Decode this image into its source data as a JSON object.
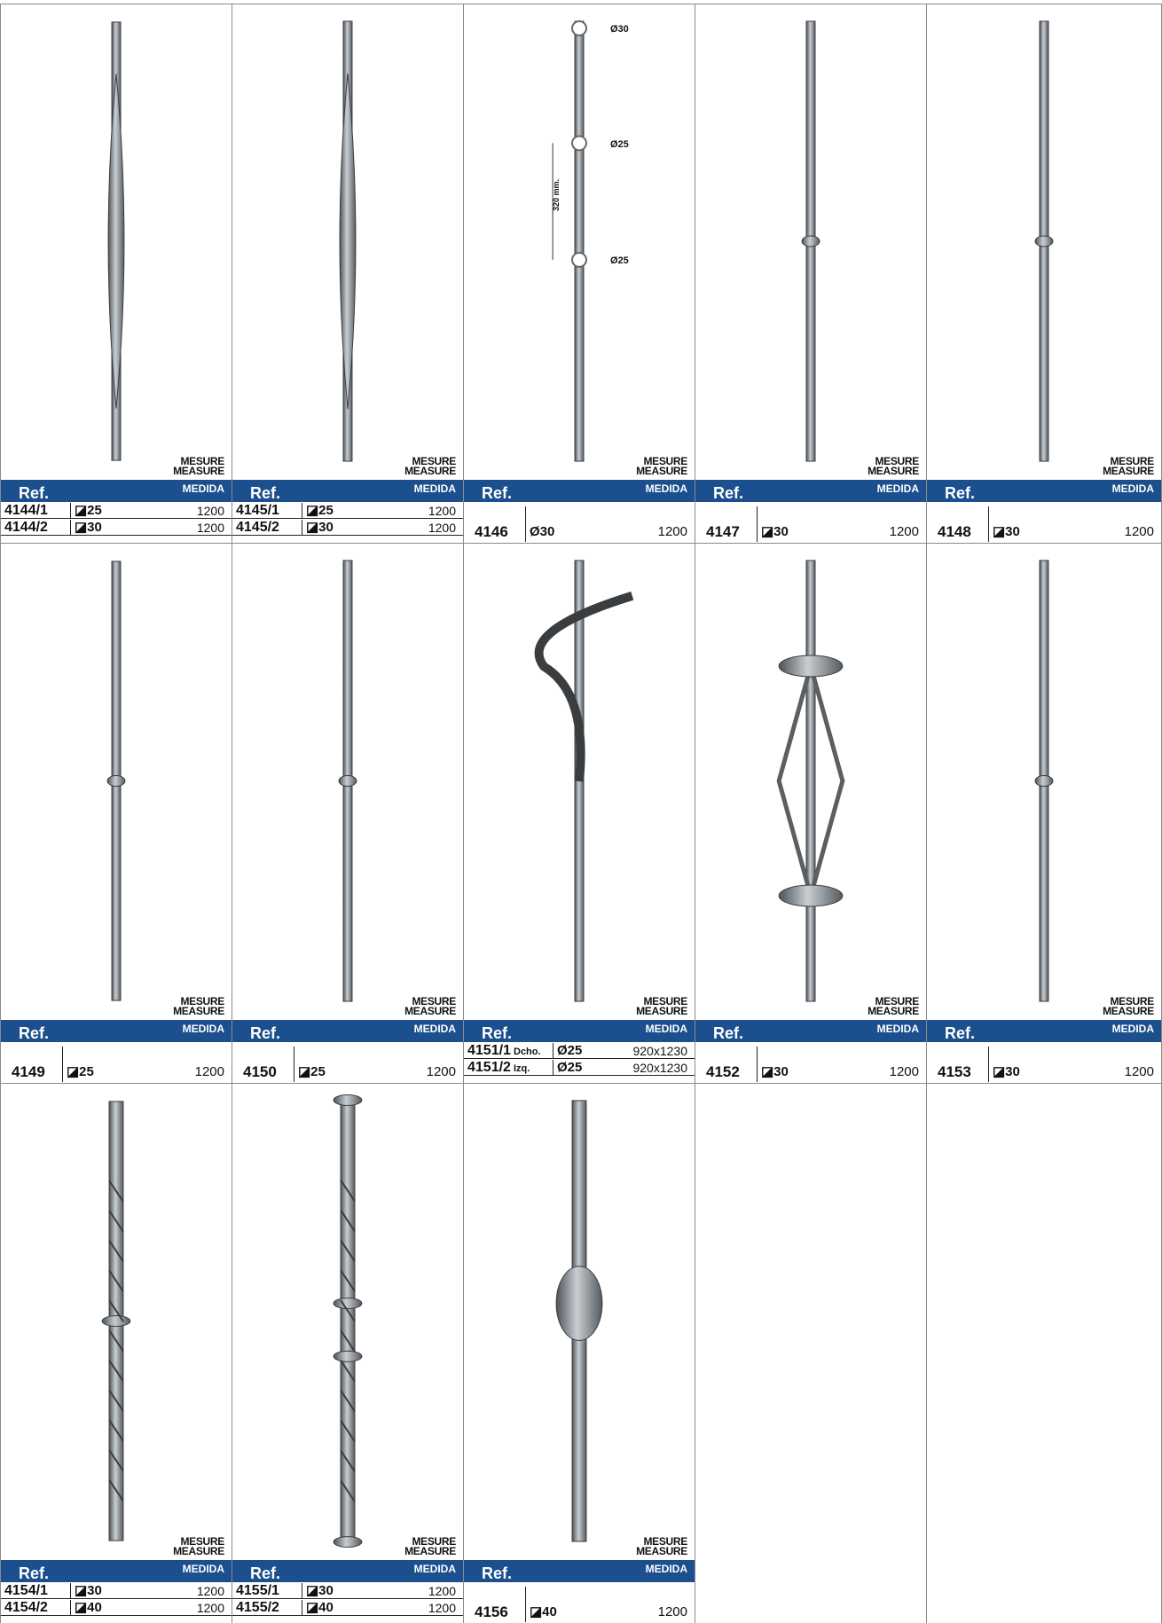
{
  "labels": {
    "ref": "Ref.",
    "mesure": "Mesure",
    "measure": "Measure",
    "medida": "Medida"
  },
  "cells": [
    {
      "rows": [
        {
          "ref": "4144/1",
          "section": "◪25",
          "measure": "1200"
        },
        {
          "ref": "4144/2",
          "section": "◪30",
          "measure": "1200"
        }
      ]
    },
    {
      "rows": [
        {
          "ref": "4145/1",
          "section": "◪25",
          "measure": "1200"
        },
        {
          "ref": "4145/2",
          "section": "◪30",
          "measure": "1200"
        }
      ]
    },
    {
      "single": {
        "ref": "4146",
        "section": "Ø30",
        "measure": "1200"
      },
      "annotations": {
        "top": "Ø30",
        "mid1": "Ø25",
        "mid2": "Ø25",
        "spacing": "320 mm."
      }
    },
    {
      "single": {
        "ref": "4147",
        "section": "◪30",
        "measure": "1200"
      }
    },
    {
      "single": {
        "ref": "4148",
        "section": "◪30",
        "measure": "1200"
      }
    },
    {
      "single": {
        "ref": "4149",
        "section": "◪25",
        "measure": "1200"
      }
    },
    {
      "single": {
        "ref": "4150",
        "section": "◪25",
        "measure": "1200"
      }
    },
    {
      "rows": [
        {
          "ref": "4151/1",
          "dir": "Dcho.",
          "section": "Ø25",
          "measure": "920x1230"
        },
        {
          "ref": "4151/2",
          "dir": "Izq.",
          "section": "Ø25",
          "measure": "920x1230"
        }
      ]
    },
    {
      "single": {
        "ref": "4152",
        "section": "◪30",
        "measure": "1200"
      }
    },
    {
      "single": {
        "ref": "4153",
        "section": "◪30",
        "measure": "1200"
      }
    },
    {
      "rows": [
        {
          "ref": "4154/1",
          "section": "◪30",
          "measure": "1200"
        },
        {
          "ref": "4154/2",
          "section": "◪40",
          "measure": "1200"
        }
      ]
    },
    {
      "rows": [
        {
          "ref": "4155/1",
          "section": "◪30",
          "measure": "1200"
        },
        {
          "ref": "4155/2",
          "section": "◪40",
          "measure": "1200"
        }
      ]
    },
    {
      "single": {
        "ref": "4156",
        "section": "◪40",
        "measure": "1200"
      }
    }
  ],
  "colors": {
    "header": "#1b4f8d",
    "metal": "#8f9499"
  }
}
